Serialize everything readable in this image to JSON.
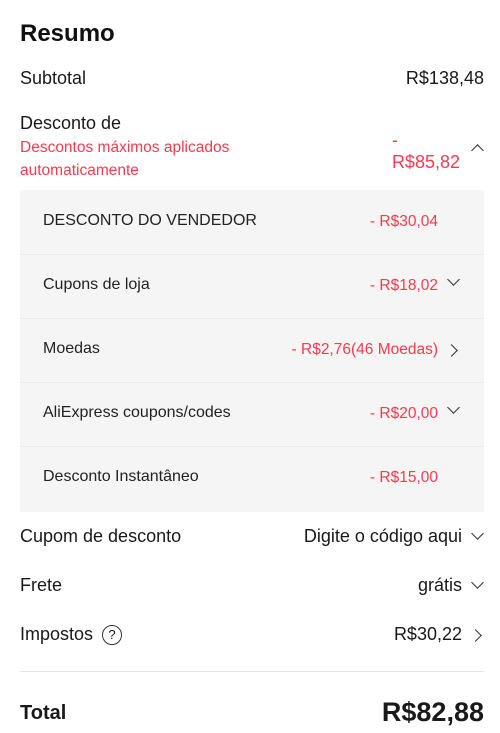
{
  "summary": {
    "title": "Resumo",
    "subtotal_label": "Subtotal",
    "subtotal_value": "R$138,48",
    "discount_label": "Desconto de",
    "discount_note": "Descontos máximos aplicados automaticamente",
    "discount_dash": "-",
    "discount_value": "R$85,82",
    "details": [
      {
        "label": "DESCONTO DO VENDEDOR",
        "value": "- R$30,04",
        "chevron": "none"
      },
      {
        "label": "Cupons de loja",
        "value": "- R$18,02",
        "chevron": "down"
      },
      {
        "label": "Moedas",
        "value": "- R$2,76(46 Moedas)",
        "chevron": "right"
      },
      {
        "label": "AliExpress coupons/codes",
        "value": "- R$20,00",
        "chevron": "down"
      },
      {
        "label": "Desconto Instantâneo",
        "value": "- R$15,00",
        "chevron": "none"
      }
    ],
    "coupon_label": "Cupom de desconto",
    "coupon_placeholder": "Digite o código aqui",
    "shipping_label": "Frete",
    "shipping_value": "grátis",
    "taxes_label": "Impostos",
    "taxes_help": "?",
    "taxes_value": "R$30,22",
    "total_label": "Total",
    "total_value": "R$82,88"
  },
  "colors": {
    "accent": "#fd384f",
    "panel": "#f5f5f5"
  }
}
